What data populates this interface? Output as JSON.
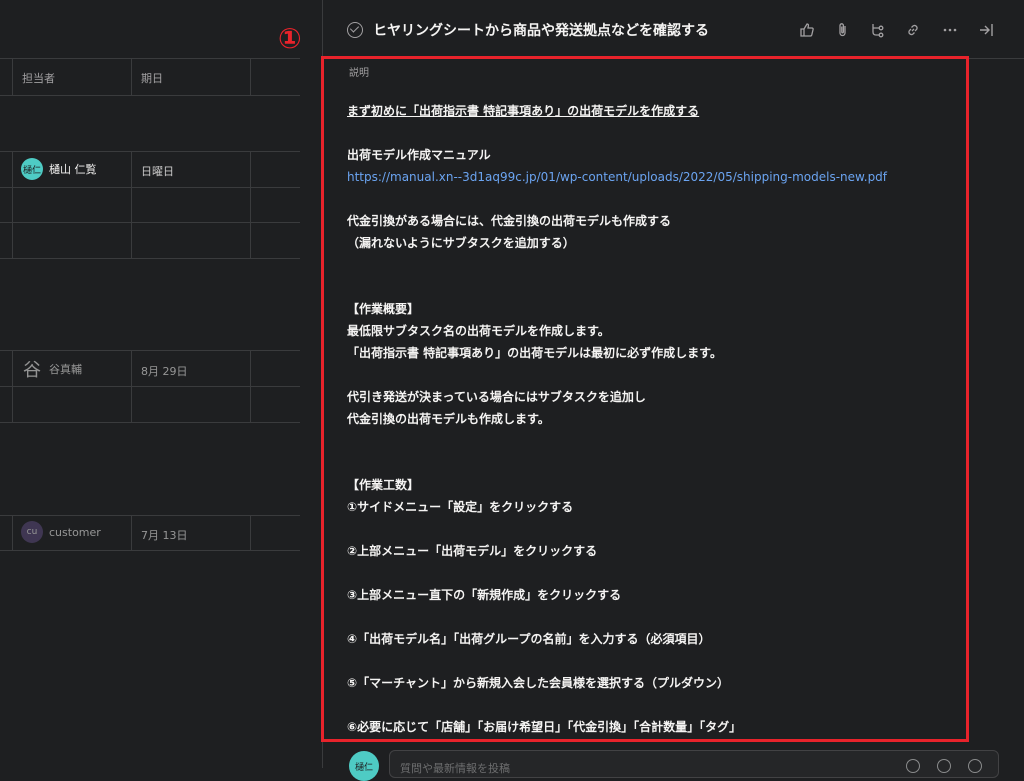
{
  "task_list": {
    "columns": {
      "assignee": "担当者",
      "due": "期日"
    },
    "rows": [
      {
        "avatar_text": "樋仁",
        "avatar_color": "#4ecbc4",
        "assignee": "樋山 仁覧",
        "due": "日曜日",
        "dim": false
      },
      {
        "avatar_text": "谷",
        "avatar_color": "",
        "assignee": "谷真輔",
        "due": "8月 29日",
        "dim": true
      },
      {
        "avatar_text": "cu",
        "avatar_color": "#5a4a7a",
        "assignee": "customer",
        "due": "7月 13日",
        "dim": true
      }
    ]
  },
  "annotation_marker": "①",
  "task": {
    "title": "ヒヤリングシートから商品や発送拠点などを確認する",
    "header_icons": [
      "thumbs-up-icon",
      "attachment-icon",
      "subtask-icon",
      "link-icon",
      "more-icon",
      "close-panel-icon"
    ],
    "description_label": "説明",
    "description_lines": [
      {
        "text": "まず初めに「出荷指示書 特記事項あり」の出荷モデルを作成する",
        "style": "u"
      },
      {
        "text": "",
        "style": ""
      },
      {
        "text": "出荷モデル作成マニュアル",
        "style": ""
      },
      {
        "text": "https://manual.xn--3d1aq99c.jp/01/wp-content/uploads/2022/05/shipping-models-new.pdf",
        "style": "link"
      },
      {
        "text": "",
        "style": ""
      },
      {
        "text": "代金引換がある場合には、代金引換の出荷モデルも作成する",
        "style": ""
      },
      {
        "text": "（漏れないようにサブタスクを追加する）",
        "style": ""
      },
      {
        "text": "",
        "style": ""
      },
      {
        "text": "",
        "style": ""
      },
      {
        "text": "【作業概要】",
        "style": ""
      },
      {
        "text": "最低限サブタスク名の出荷モデルを作成します。",
        "style": ""
      },
      {
        "text": "「出荷指示書 特記事項あり」の出荷モデルは最初に必ず作成します。",
        "style": ""
      },
      {
        "text": "",
        "style": ""
      },
      {
        "text": "代引き発送が決まっている場合にはサブタスクを追加し",
        "style": ""
      },
      {
        "text": "代金引換の出荷モデルも作成します。",
        "style": ""
      },
      {
        "text": "",
        "style": ""
      },
      {
        "text": "",
        "style": ""
      },
      {
        "text": "【作業工数】",
        "style": ""
      },
      {
        "text": "①サイドメニュー「設定」をクリックする",
        "style": ""
      },
      {
        "text": "",
        "style": ""
      },
      {
        "text": "②上部メニュー「出荷モデル」をクリックする",
        "style": ""
      },
      {
        "text": "",
        "style": ""
      },
      {
        "text": "③上部メニュー直下の「新規作成」をクリックする",
        "style": ""
      },
      {
        "text": "",
        "style": ""
      },
      {
        "text": "④「出荷モデル名」「出荷グループの名前」を入力する（必須項目）",
        "style": ""
      },
      {
        "text": "",
        "style": ""
      },
      {
        "text": "⑤「マーチャント」から新規入会した会員様を選択する（プルダウン）",
        "style": ""
      },
      {
        "text": "",
        "style": ""
      },
      {
        "text": "⑥必要に応じて「店舗」「お届け希望日」「代金引換」「合計数量」「タグ」",
        "style": ""
      }
    ]
  },
  "comment": {
    "avatar_text": "樋仁",
    "placeholder": "質問や最新情報を投稿"
  },
  "colors": {
    "accent_red": "#e8232b",
    "link": "#6ba4f1",
    "background": "#1e1f21"
  }
}
